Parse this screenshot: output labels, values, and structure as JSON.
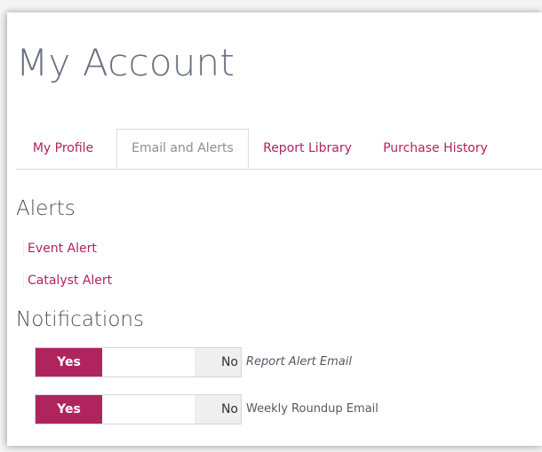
{
  "page": {
    "title": "My Account"
  },
  "tabs": [
    {
      "label": "My Profile",
      "active": false
    },
    {
      "label": "Email and Alerts",
      "active": true
    },
    {
      "label": "Report Library",
      "active": false
    },
    {
      "label": "Purchase History",
      "active": false
    }
  ],
  "alerts": {
    "heading": "Alerts",
    "items": [
      {
        "label": "Event Alert"
      },
      {
        "label": "Catalyst Alert"
      }
    ]
  },
  "notifications": {
    "heading": "Notifications",
    "items": [
      {
        "yes_label": "Yes",
        "no_label": "No",
        "label": "Report Alert Email",
        "value": "Yes"
      },
      {
        "yes_label": "Yes",
        "no_label": "No",
        "label": "Weekly Roundup Email",
        "value": "Yes"
      }
    ]
  },
  "colors": {
    "accent": "#b0245e",
    "title": "#6a7180",
    "inactive_tab_text": "#8a8f98",
    "toggle_off_bg": "#efefef"
  }
}
